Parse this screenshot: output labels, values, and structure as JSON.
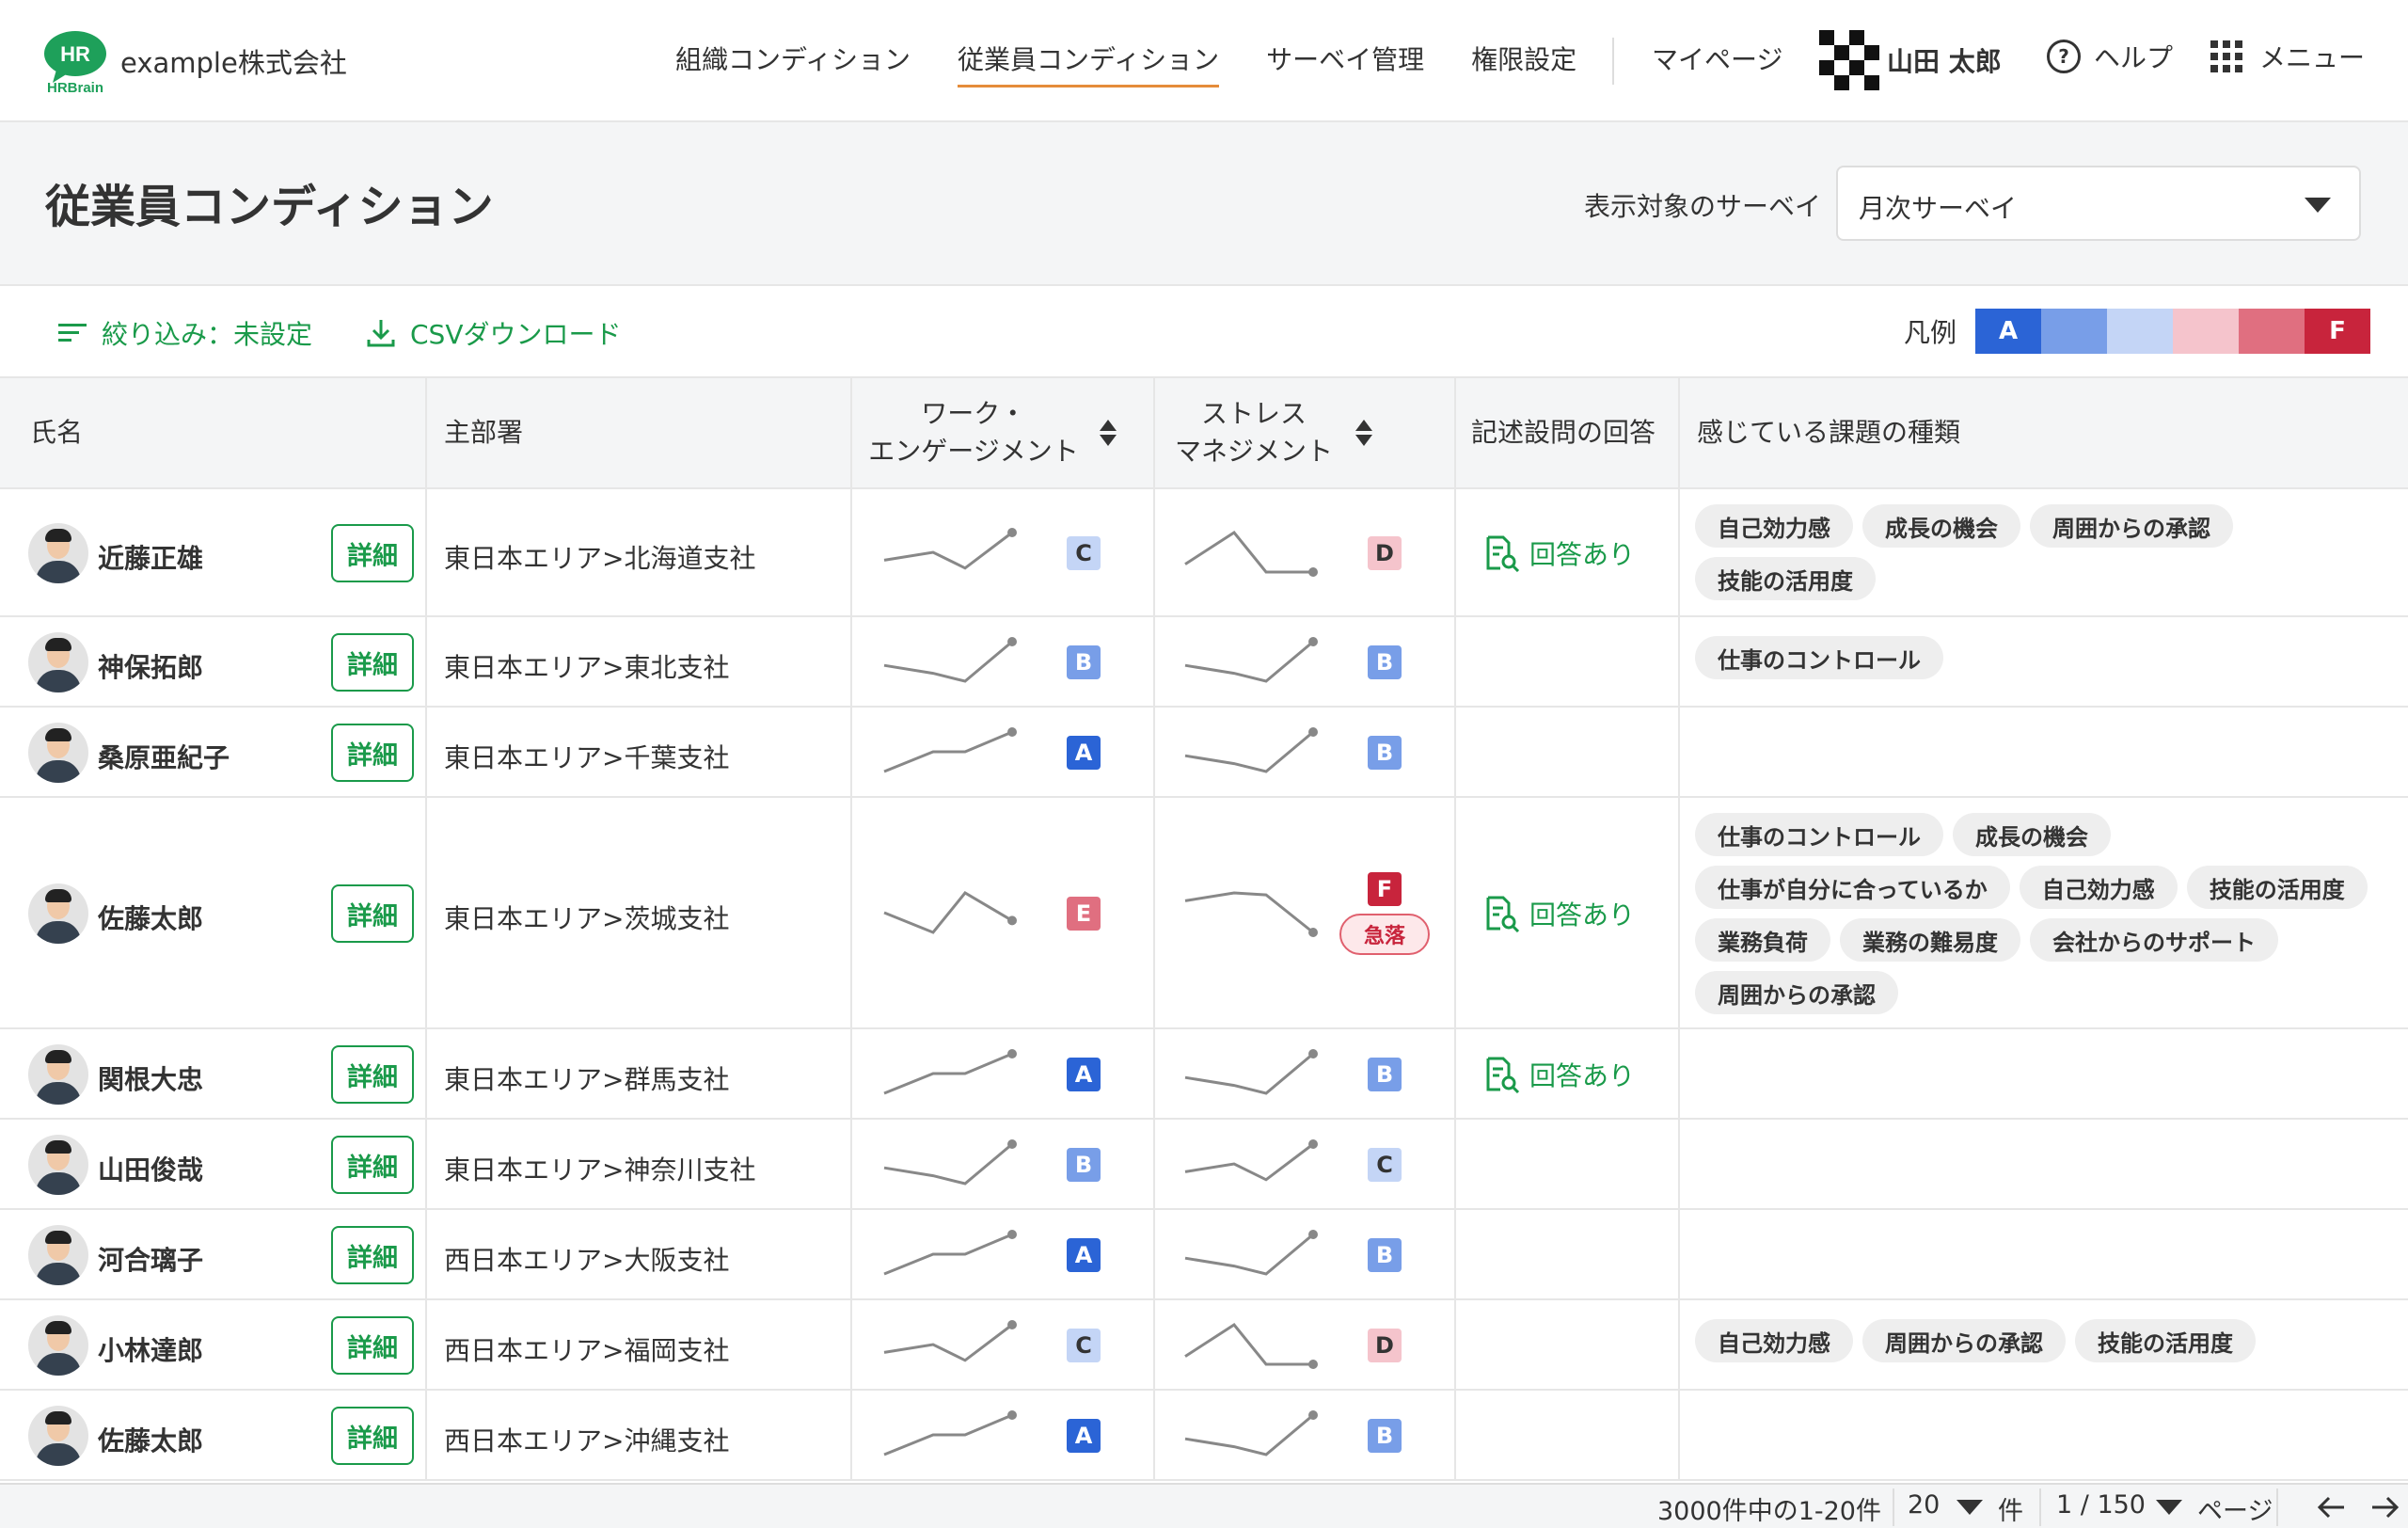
{
  "header": {
    "company": "example株式会社",
    "logo_text": "HR",
    "logo_sub": "HRBrain",
    "nav": [
      "組織コンディション",
      "従業員コンディション",
      "サーベイ管理",
      "権限設定"
    ],
    "nav_active": 1,
    "mypage": "マイページ",
    "user_name": "山田 太郎",
    "help": "ヘルプ",
    "menu": "メニュー"
  },
  "page": {
    "title": "従業員コンディション",
    "survey_label": "表示対象のサーベイ",
    "survey_value": "月次サーベイ"
  },
  "toolbar": {
    "filter": "絞り込み：未設定",
    "csv": "CSVダウンロード",
    "legend_label": "凡例",
    "legend_colors": [
      "#2b64d6",
      "#789ee8",
      "#c4d5f6",
      "#f5c4cc",
      "#e06f80",
      "#c8243c"
    ],
    "legend_first": "A",
    "legend_last": "F"
  },
  "table": {
    "headers": {
      "name": "氏名",
      "dept": "主部署",
      "we_line1": "ワーク・",
      "we_line2": "エンゲージメント",
      "sm_line1": "ストレス",
      "sm_line2": "マネジメント",
      "free": "記述設問の回答",
      "issues": "感じている課題の種類"
    },
    "detail_label": "詳細",
    "answer_label": "回答あり",
    "drop_label": "急落",
    "rows": [
      {
        "name": "近藤正雄",
        "dept": "東日本エリア>北海道支社",
        "we_trend": [
          0.3,
          0.5,
          0.1,
          1.0
        ],
        "we_grade": "C",
        "sm_trend": [
          0.2,
          1.0,
          0.0,
          0.0
        ],
        "sm_grade": "D",
        "answer": true,
        "drop": false,
        "issues": [
          "自己効力感",
          "成長の機会",
          "周囲からの承認",
          "技能の活用度"
        ]
      },
      {
        "name": "神保拓郎",
        "dept": "東日本エリア>東北支社",
        "we_trend": [
          0.4,
          0.2,
          0.0,
          1.0
        ],
        "we_grade": "B",
        "sm_trend": [
          0.4,
          0.2,
          0.0,
          1.0
        ],
        "sm_grade": "B",
        "answer": false,
        "drop": false,
        "issues": [
          "仕事のコントロール"
        ]
      },
      {
        "name": "桑原亜紀子",
        "dept": "東日本エリア>千葉支社",
        "we_trend": [
          0.0,
          0.5,
          0.5,
          1.0
        ],
        "we_grade": "A",
        "sm_trend": [
          0.4,
          0.2,
          0.0,
          1.0
        ],
        "sm_grade": "B",
        "answer": false,
        "drop": false,
        "issues": []
      },
      {
        "name": "佐藤太郎",
        "dept": "東日本エリア>茨城支社",
        "we_trend": [
          0.5,
          0.0,
          1.0,
          0.3
        ],
        "we_grade": "E",
        "sm_trend": [
          0.8,
          1.0,
          0.95,
          0.0
        ],
        "sm_grade": "F",
        "answer": true,
        "drop": true,
        "issues": [
          "仕事のコントロール",
          "成長の機会",
          "仕事が自分に合っているか",
          "自己効力感",
          "技能の活用度",
          "業務負荷",
          "業務の難易度",
          "会社からのサポート",
          "周囲からの承認"
        ]
      },
      {
        "name": "関根大忠",
        "dept": "東日本エリア>群馬支社",
        "we_trend": [
          0.0,
          0.5,
          0.5,
          1.0
        ],
        "we_grade": "A",
        "sm_trend": [
          0.4,
          0.2,
          0.0,
          1.0
        ],
        "sm_grade": "B",
        "answer": true,
        "drop": false,
        "issues": []
      },
      {
        "name": "山田俊哉",
        "dept": "東日本エリア>神奈川支社",
        "we_trend": [
          0.4,
          0.2,
          0.0,
          1.0
        ],
        "we_grade": "B",
        "sm_trend": [
          0.3,
          0.5,
          0.1,
          1.0
        ],
        "sm_grade": "C",
        "answer": false,
        "drop": false,
        "issues": []
      },
      {
        "name": "河合璃子",
        "dept": "西日本エリア>大阪支社",
        "we_trend": [
          0.0,
          0.5,
          0.5,
          1.0
        ],
        "we_grade": "A",
        "sm_trend": [
          0.4,
          0.2,
          0.0,
          1.0
        ],
        "sm_grade": "B",
        "answer": false,
        "drop": false,
        "issues": []
      },
      {
        "name": "小林達郎",
        "dept": "西日本エリア>福岡支社",
        "we_trend": [
          0.3,
          0.5,
          0.1,
          1.0
        ],
        "we_grade": "C",
        "sm_trend": [
          0.2,
          1.0,
          0.0,
          0.0
        ],
        "sm_grade": "D",
        "answer": false,
        "drop": false,
        "issues": [
          "自己効力感",
          "周囲からの承認",
          "技能の活用度"
        ]
      },
      {
        "name": "佐藤太郎",
        "dept": "西日本エリア>沖縄支社",
        "we_trend": [
          0.0,
          0.5,
          0.5,
          1.0
        ],
        "we_grade": "A",
        "sm_trend": [
          0.4,
          0.2,
          0.0,
          1.0
        ],
        "sm_grade": "B",
        "answer": false,
        "drop": false,
        "issues": []
      }
    ]
  },
  "grade_colors": {
    "A": {
      "bg": "#2b64d6",
      "fg": "#ffffff"
    },
    "B": {
      "bg": "#789ee8",
      "fg": "#ffffff"
    },
    "C": {
      "bg": "#c4d5f6",
      "fg": "#333333"
    },
    "D": {
      "bg": "#f5c4cc",
      "fg": "#333333"
    },
    "E": {
      "bg": "#e06f80",
      "fg": "#ffffff"
    },
    "F": {
      "bg": "#c8243c",
      "fg": "#ffffff"
    }
  },
  "footer": {
    "range": "3000件中の1-20件",
    "per_page": "20",
    "per_unit": "件",
    "page": "1 / 150",
    "page_unit": "ページ"
  }
}
